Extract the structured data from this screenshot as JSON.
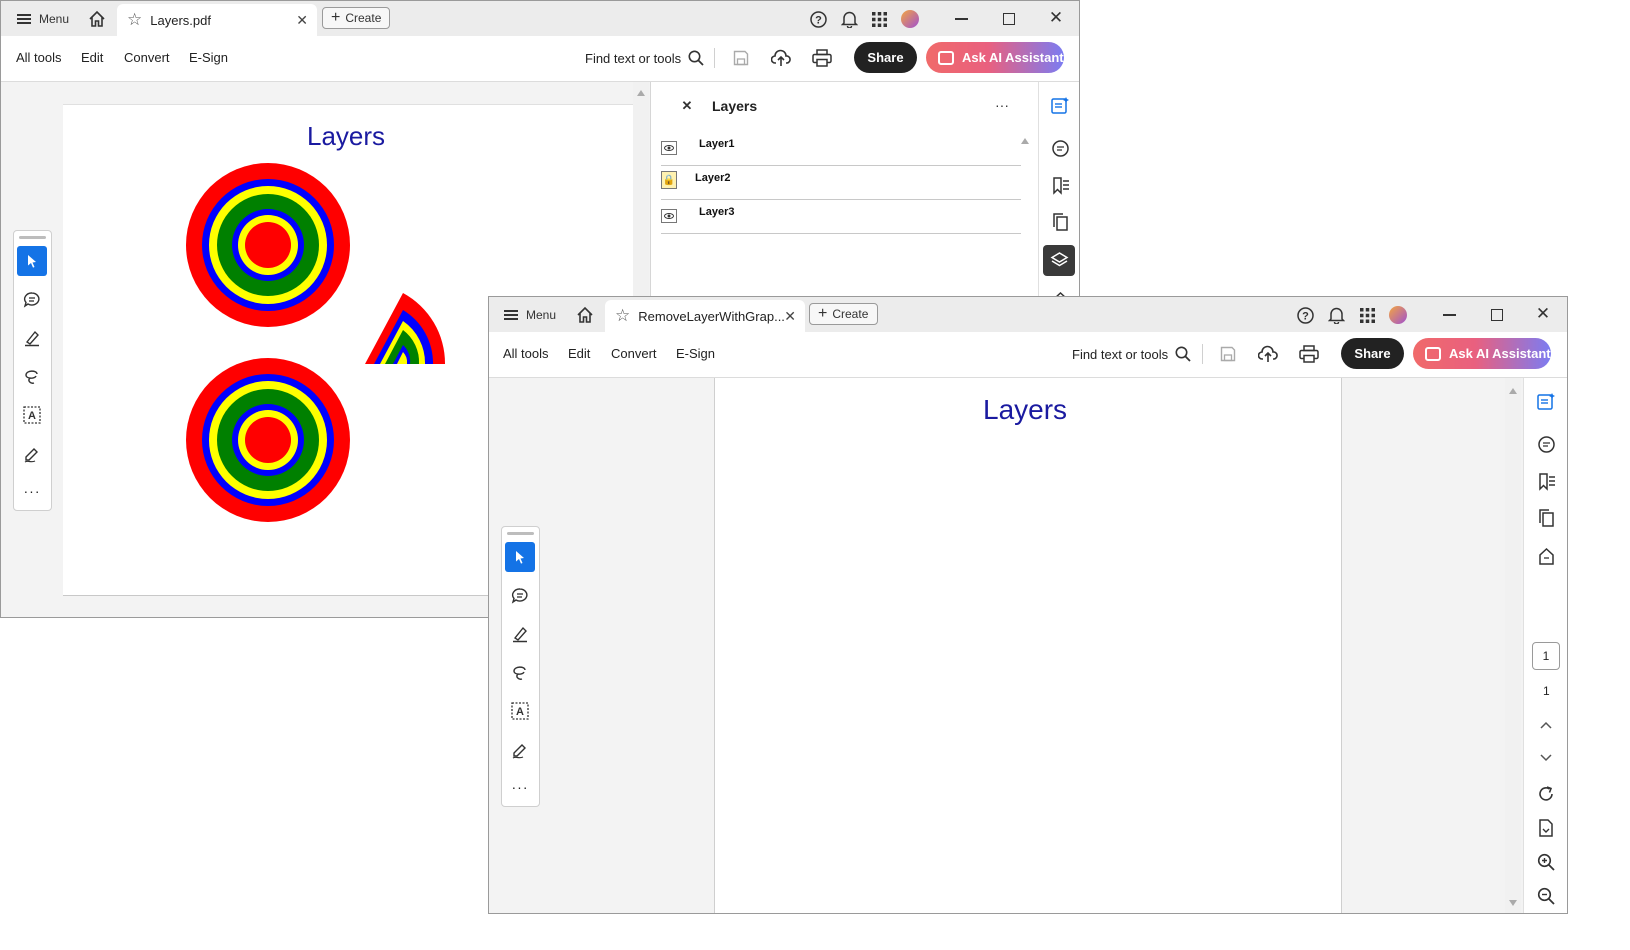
{
  "window1": {
    "menu_label": "Menu",
    "tab_title": "Layers.pdf",
    "create_label": "Create",
    "toolbar": {
      "all_tools": "All tools",
      "edit": "Edit",
      "convert": "Convert",
      "esign": "E-Sign",
      "find": "Find text or tools",
      "share": "Share",
      "ai": "Ask AI Assistant"
    },
    "document_title": "Layers",
    "layers_panel": {
      "title": "Layers",
      "layers": [
        {
          "name": "Layer1",
          "state": "visible"
        },
        {
          "name": "Layer2",
          "state": "locked"
        },
        {
          "name": "Layer3",
          "state": "visible"
        }
      ]
    }
  },
  "window2": {
    "menu_label": "Menu",
    "tab_title": "RemoveLayerWithGrap...",
    "create_label": "Create",
    "toolbar": {
      "all_tools": "All tools",
      "edit": "Edit",
      "convert": "Convert",
      "esign": "E-Sign",
      "find": "Find text or tools",
      "share": "Share",
      "ai": "Ask AI Assistant"
    },
    "document_title": "Layers",
    "page_current": "1",
    "page_total": "1"
  },
  "colors": {
    "accent_blue": "#1473e6",
    "title_blue": "#1a1aa0",
    "ring_red": "#ff0000",
    "ring_blue": "#0000ff",
    "ring_yellow": "#ffff00",
    "ring_green": "#008000"
  },
  "icons": [
    "menu-icon",
    "home-icon",
    "star-icon",
    "close-icon",
    "plus-icon",
    "help-icon",
    "bell-icon",
    "apps-icon",
    "avatar",
    "minimize-icon",
    "maximize-icon",
    "search-icon",
    "save-icon",
    "upload-icon",
    "print-icon",
    "ai-spark-icon",
    "select-icon",
    "comment-icon",
    "highlight-icon",
    "lasso-icon",
    "text-recognition-icon",
    "sign-icon",
    "more-icon",
    "eye-icon",
    "lock-icon",
    "layers-icon",
    "bookmark-icon",
    "pages-icon",
    "rotate-icon",
    "zoom-in-icon",
    "zoom-out-icon"
  ]
}
